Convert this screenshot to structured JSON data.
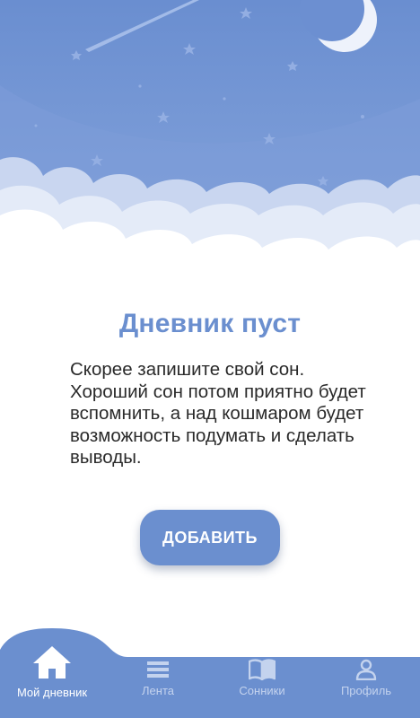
{
  "empty_state": {
    "title": "Дневник пуст",
    "description": "Скорее запишите свой сон. Хороший сон потом приятно будет вспомнить, а над кошмаром будет возможность подумать и сделать выводы.",
    "add_button_label": "ДОБАВИТЬ"
  },
  "bottom_nav": {
    "items": [
      {
        "label": "Мой дневник",
        "icon": "home-icon",
        "active": true
      },
      {
        "label": "Лента",
        "icon": "feed-icon",
        "active": false
      },
      {
        "label": "Сонники",
        "icon": "book-icon",
        "active": false
      },
      {
        "label": "Профиль",
        "icon": "profile-icon",
        "active": false
      }
    ]
  },
  "colors": {
    "accent": "#6b8fcf",
    "sky_top": "#6f92d2",
    "nav_inactive": "#c4d3ee",
    "text": "#2a2a2a"
  }
}
